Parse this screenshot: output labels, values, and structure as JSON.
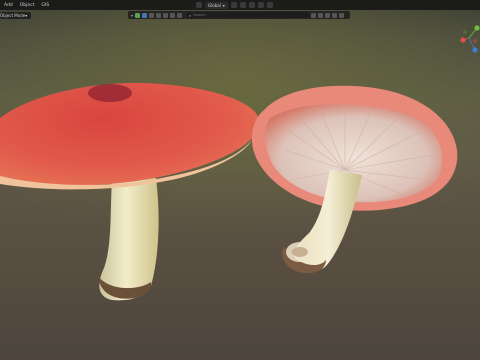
{
  "header": {
    "menu": [
      "Add",
      "Object",
      "GIS"
    ],
    "mode": "Object Mode",
    "orientation": "Global"
  },
  "viewport_toolbar": {
    "search_placeholder": "Search"
  },
  "gizmo": {
    "axes": [
      "X",
      "Y",
      "Z"
    ],
    "colors": {
      "x": "#e54c4c",
      "y": "#6bbf3a",
      "z": "#3f7fd9"
    }
  },
  "scene": {
    "objects": [
      "mushroom-left",
      "mushroom-right"
    ],
    "accent_colors": {
      "cap": "#e2574b",
      "stem": "#efe7c4",
      "background": "#575240"
    }
  }
}
